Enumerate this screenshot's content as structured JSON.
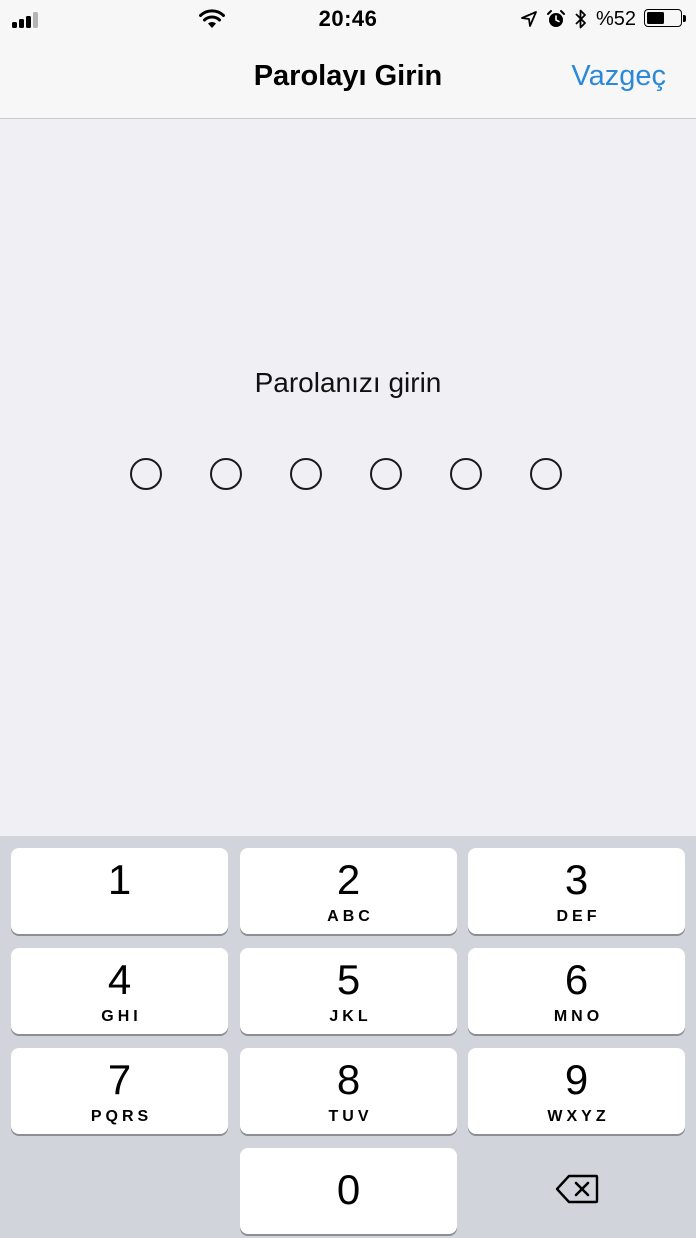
{
  "status_bar": {
    "time": "20:46",
    "battery_percent": "%52",
    "battery_level": 0.52,
    "signal_bars_active": 3,
    "signal_bars_total": 4
  },
  "nav": {
    "title": "Parolayı Girin",
    "cancel_label": "Vazgeç"
  },
  "passcode": {
    "prompt": "Parolanızı girin",
    "length": 6,
    "entered": 0
  },
  "keypad": {
    "keys": [
      {
        "num": "1",
        "letters": ""
      },
      {
        "num": "2",
        "letters": "ABC"
      },
      {
        "num": "3",
        "letters": "DEF"
      },
      {
        "num": "4",
        "letters": "GHI"
      },
      {
        "num": "5",
        "letters": "JKL"
      },
      {
        "num": "6",
        "letters": "MNO"
      },
      {
        "num": "7",
        "letters": "PQRS"
      },
      {
        "num": "8",
        "letters": "TUV"
      },
      {
        "num": "9",
        "letters": "WXYZ"
      },
      {
        "num": "0",
        "letters": ""
      }
    ],
    "delete_icon": "backspace-icon"
  },
  "colors": {
    "accent": "#2a89d8",
    "background": "#efeff4",
    "keypad_background": "#d1d4da"
  }
}
